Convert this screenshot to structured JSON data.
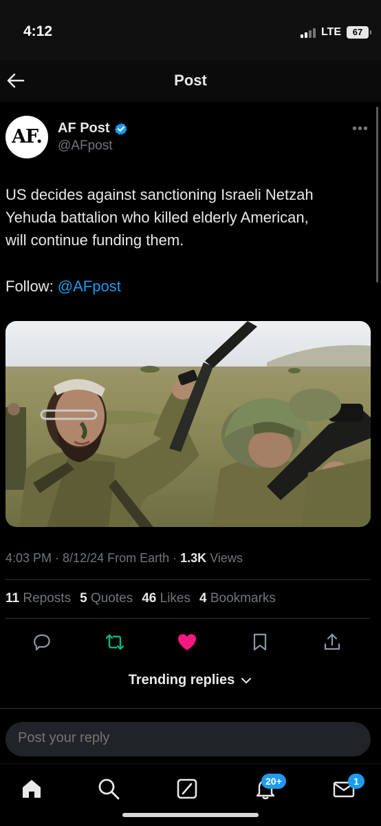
{
  "status_bar": {
    "time": "4:12",
    "network": "LTE",
    "battery": "67"
  },
  "header": {
    "title": "Post"
  },
  "author": {
    "avatar_text": "AF.",
    "name": "AF Post",
    "handle": "@AFpost"
  },
  "tweet": {
    "lines": [
      "US decides against sanctioning Israeli Netzah",
      "Yehuda battalion who killed elderly American,",
      "will continue funding them."
    ],
    "follow_label": "Follow: ",
    "follow_mention": "@AFpost"
  },
  "meta": {
    "time": "4:03 PM",
    "date": "8/12/24",
    "source": "From Earth",
    "views_count": "1.3K",
    "views_label": "Views"
  },
  "counts": {
    "reposts": {
      "value": "11",
      "label": "Reposts"
    },
    "quotes": {
      "value": "5",
      "label": "Quotes"
    },
    "likes": {
      "value": "46",
      "label": "Likes"
    },
    "bookmarks": {
      "value": "4",
      "label": "Bookmarks"
    }
  },
  "actions": {
    "reply_icon": "reply-icon",
    "repost_icon": "repost-icon",
    "like_icon": "heart-icon",
    "bookmark_icon": "bookmark-icon",
    "share_icon": "share-icon"
  },
  "trending": {
    "label": "Trending replies"
  },
  "reply": {
    "placeholder": "Post your reply"
  },
  "tabbar": {
    "notifications_badge": "20+",
    "messages_badge": "1"
  },
  "colors": {
    "accent": "#1d9bf0",
    "repost_active": "#00ba7c",
    "like_active": "#f91880",
    "muted": "#71767b"
  }
}
